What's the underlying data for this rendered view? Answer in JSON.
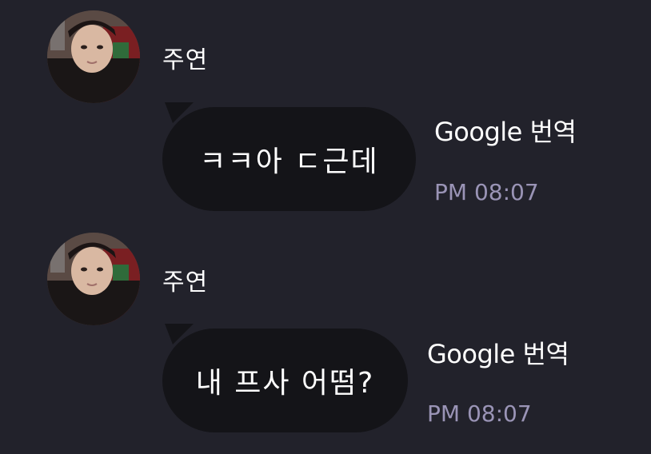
{
  "messages": [
    {
      "sender": "주연",
      "text": "ㅋㅋ아 ㄷ근데",
      "translate_label": "Google 번역",
      "time": "PM 08:07"
    },
    {
      "sender": "주연",
      "text": "내 프사 어떰?",
      "translate_label": "Google 번역",
      "time": "PM 08:07"
    }
  ],
  "colors": {
    "background": "#22222b",
    "bubble": "#141418",
    "text": "#ffffff",
    "timestamp": "#9a94b6"
  }
}
